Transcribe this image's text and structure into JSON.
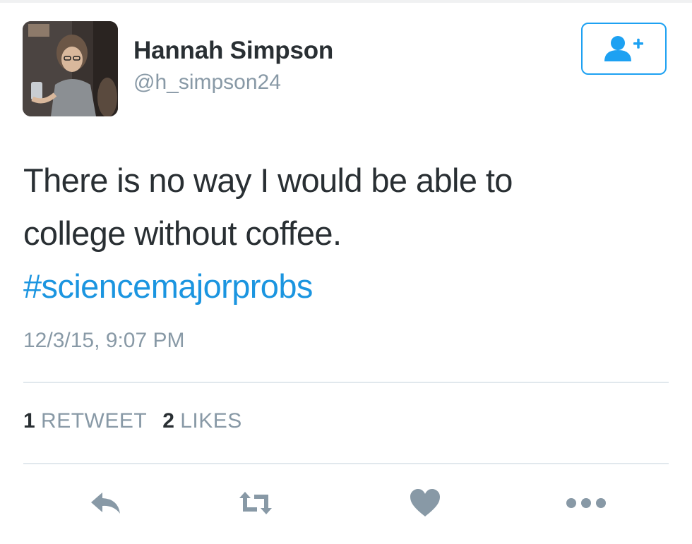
{
  "tweet": {
    "author": {
      "name": "Hannah Simpson",
      "handle": "@h_simpson24",
      "avatar_icon": "profile-photo"
    },
    "follow_button": {
      "icon": "add-user-icon",
      "color": "#1da1f2"
    },
    "text_lines": [
      "There is no way I would be able to",
      "college without coffee."
    ],
    "hashtag": "#sciencemajorprobs",
    "timestamp": "12/3/15, 9:07 PM",
    "stats": {
      "retweet_count": "1",
      "retweet_label": "RETWEET",
      "like_count": "2",
      "like_label": "LIKES"
    },
    "actions": [
      {
        "icon": "reply-icon"
      },
      {
        "icon": "retweet-icon"
      },
      {
        "icon": "heart-icon"
      },
      {
        "icon": "more-icon"
      }
    ],
    "colors": {
      "link": "#1b95e0",
      "secondary_text": "#8899a6",
      "primary_text": "#292f33",
      "action_icon": "#8899a6"
    }
  }
}
